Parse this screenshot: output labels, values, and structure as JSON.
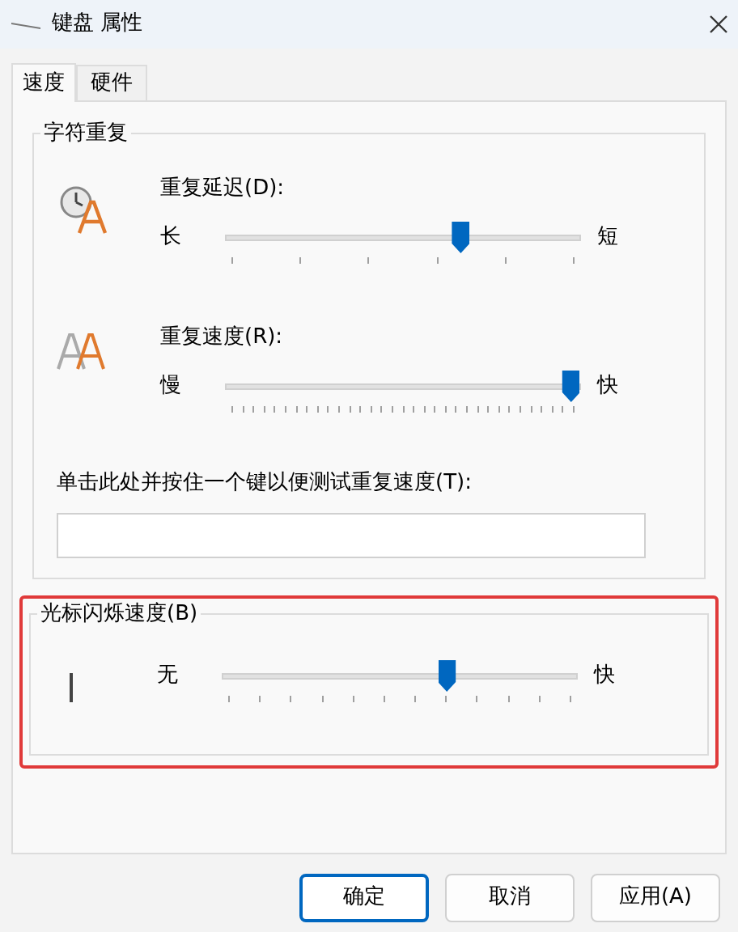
{
  "window": {
    "title": "键盘 属性"
  },
  "tabs": [
    {
      "label": "速度",
      "selected": true
    },
    {
      "label": "硬件",
      "selected": false
    }
  ],
  "character_repeat": {
    "title": "字符重复",
    "sliders": [
      {
        "label": "重复延迟(D):",
        "min_label": "长",
        "max_label": "短",
        "level": 0.66
      },
      {
        "label": "重复速度(R):",
        "min_label": "慢",
        "max_label": "快",
        "level": 0.97
      }
    ],
    "test": {
      "label": "单击此处并按住一个键以便测试重复速度(T):"
    }
  },
  "cursor_blink": {
    "title": "光标闪烁速度(B)",
    "highlighted": true,
    "min_label": "无",
    "max_label": "快",
    "level": 0.63
  },
  "buttons": [
    {
      "label": "确定",
      "default": true
    },
    {
      "label": "取消",
      "default": false
    },
    {
      "label": "应用(A)",
      "default": false
    }
  ]
}
